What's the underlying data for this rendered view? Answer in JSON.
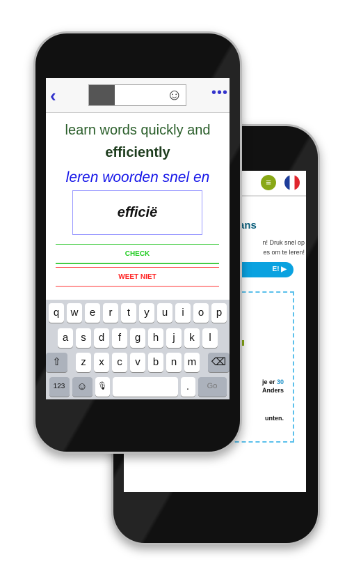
{
  "back_phone": {
    "menu_icon": "hamburger-menu-icon",
    "flag_icon": "french-flag-icon",
    "title_fragment": "Frans",
    "intro_line1": "n! Druk snel op",
    "intro_line2": "es om te leren!",
    "start_button": "E! ▶",
    "card_line1_a": "je er ",
    "card_line1_b": "30",
    "card_line2": "Anders",
    "card_line3": "unten."
  },
  "front_phone": {
    "header": {
      "back_icon": "‹",
      "emoji_icon": "☺",
      "more_icon": "•••"
    },
    "prompt_line1": "learn words quickly and",
    "prompt_line2": "efficiently",
    "translation_partial": "leren woorden snel en",
    "answer_value": "efficië",
    "check_button": "CHECK",
    "dont_know_button": "WEET NIET",
    "colors": {
      "check": "#22cc22",
      "dont_know": "#ff2222",
      "translation": "#1515e8"
    },
    "keyboard": {
      "row1": [
        "q",
        "w",
        "e",
        "r",
        "t",
        "y",
        "u",
        "i",
        "o",
        "p"
      ],
      "row2": [
        "a",
        "s",
        "d",
        "f",
        "g",
        "h",
        "j",
        "k",
        "l"
      ],
      "row3": [
        "z",
        "x",
        "c",
        "v",
        "b",
        "n",
        "m"
      ],
      "shift": "⇧",
      "delete": "⌫",
      "numbers": "123",
      "emoji": "☺",
      "mic": "🎙",
      "period": ".",
      "go": "Go"
    }
  }
}
